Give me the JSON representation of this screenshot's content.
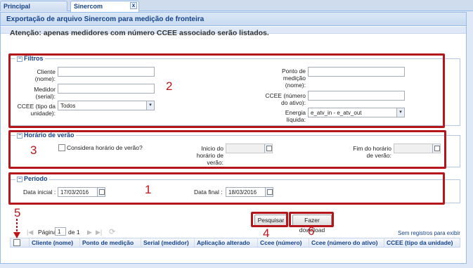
{
  "tabs": [
    {
      "label": "Principal"
    },
    {
      "label": "Sinercom"
    }
  ],
  "tab_close_glyph": "x",
  "panel": {
    "title": "Exportação de arquivo Sinercom para medição de fronteira",
    "notice": "Atenção: apenas medidores com número CCEE associado serão listados."
  },
  "filtros": {
    "legend": "Filtros",
    "collapse_glyph": "−",
    "cliente_label": "Cliente (nome):",
    "cliente_label_l1": "Cliente",
    "cliente_label_l2": "(nome):",
    "cliente_value": "",
    "medidor_label_l1": "Medidor",
    "medidor_label_l2": "(serial):",
    "medidor_value": "",
    "ccee_tipo_label_l1": "CCEE (tipo da",
    "ccee_tipo_label_l2": "unidade):",
    "ccee_tipo_value": "Todos",
    "ponto_label_l1": "Ponto de",
    "ponto_label_l2": "medição",
    "ponto_label_l3": "(nome):",
    "ponto_value": "",
    "ccee_num_label_l1": "CCEE (número",
    "ccee_num_label_l2": "do ativo):",
    "ccee_num_value": "",
    "energia_label_l1": "Energia",
    "energia_label_l2": "líquida:",
    "energia_value": "e_atv_in - e_atv_out"
  },
  "horario": {
    "legend": "Horário de verão",
    "collapse_glyph": "−",
    "checkbox_label": "Considera horário de verão?",
    "inicio_l1": "Inicio do",
    "inicio_l2": "horário de",
    "inicio_l3": "verão:",
    "inicio_value": "",
    "fim_l1": "Fim do horário",
    "fim_l2": "de verão:",
    "fim_value": ""
  },
  "periodo": {
    "legend": "Período",
    "collapse_glyph": "−",
    "inicial_label": "Data inicial :",
    "inicial_value": "17/03/2016",
    "final_label": "Data final :",
    "final_value": "18/03/2016"
  },
  "buttons": {
    "pesquisar": "Pesquisar",
    "download": "Fazer download"
  },
  "pager": {
    "page_label": "Página",
    "page_value": "1",
    "of_label": "de 1",
    "empty_text": "Sem registros para exibir",
    "first_glyph": "|◀",
    "prev_glyph": "◀",
    "next_glyph": "▶",
    "last_glyph": "▶|",
    "refresh_glyph": "⟳"
  },
  "grid": {
    "columns": [
      "Cliente (nome)",
      "Ponto de medição",
      "Serial (medidor)",
      "Aplicação alterado",
      "Ccee (número)",
      "Ccee (número do ativo)",
      "CCEE (tipo da unidade)"
    ]
  },
  "annotations": {
    "n1": "1",
    "n2": "2",
    "n3": "3",
    "n4": "4",
    "n5": "5",
    "n6": "6",
    "color": "#c0141b"
  },
  "icons": {
    "dropdown": "▾"
  }
}
